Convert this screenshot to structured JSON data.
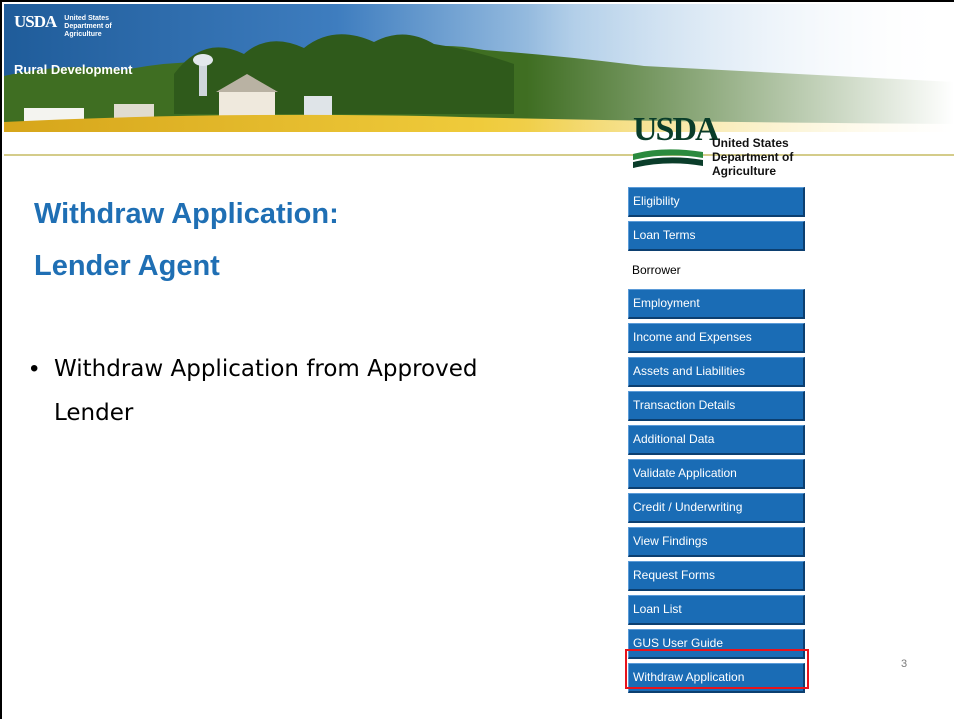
{
  "banner": {
    "org_short": "USDA",
    "org_full": [
      "United States",
      "Department of",
      "Agriculture"
    ],
    "agency": "Rural Development"
  },
  "slide": {
    "title_line1": "Withdraw Application:",
    "title_line2": "Lender Agent",
    "bullet": "Withdraw Application from Approved Lender",
    "page_number": "3"
  },
  "gus": {
    "logo_usda": "USDA",
    "logo_lines": [
      "United States",
      "Department of",
      "Agriculture"
    ],
    "nav": [
      {
        "label": "Eligibility",
        "type": "button"
      },
      {
        "label": "Loan Terms",
        "type": "button"
      },
      {
        "label": "Borrower",
        "type": "static"
      },
      {
        "label": "Employment",
        "type": "button"
      },
      {
        "label": "Income and Expenses",
        "type": "button"
      },
      {
        "label": "Assets and Liabilities",
        "type": "button"
      },
      {
        "label": "Transaction Details",
        "type": "button"
      },
      {
        "label": "Additional Data",
        "type": "button"
      },
      {
        "label": "Validate Application",
        "type": "button"
      },
      {
        "label": "Credit / Underwriting",
        "type": "button"
      },
      {
        "label": "View Findings",
        "type": "button"
      },
      {
        "label": "Request Forms",
        "type": "button"
      },
      {
        "label": "Loan List",
        "type": "button"
      },
      {
        "label": "GUS User Guide",
        "type": "button"
      },
      {
        "label": "Withdraw Application",
        "type": "button",
        "highlighted": true
      }
    ]
  },
  "colors": {
    "title": "#1f6fb4",
    "nav_button": "#1a6cb5",
    "highlight": "#e8131b"
  }
}
